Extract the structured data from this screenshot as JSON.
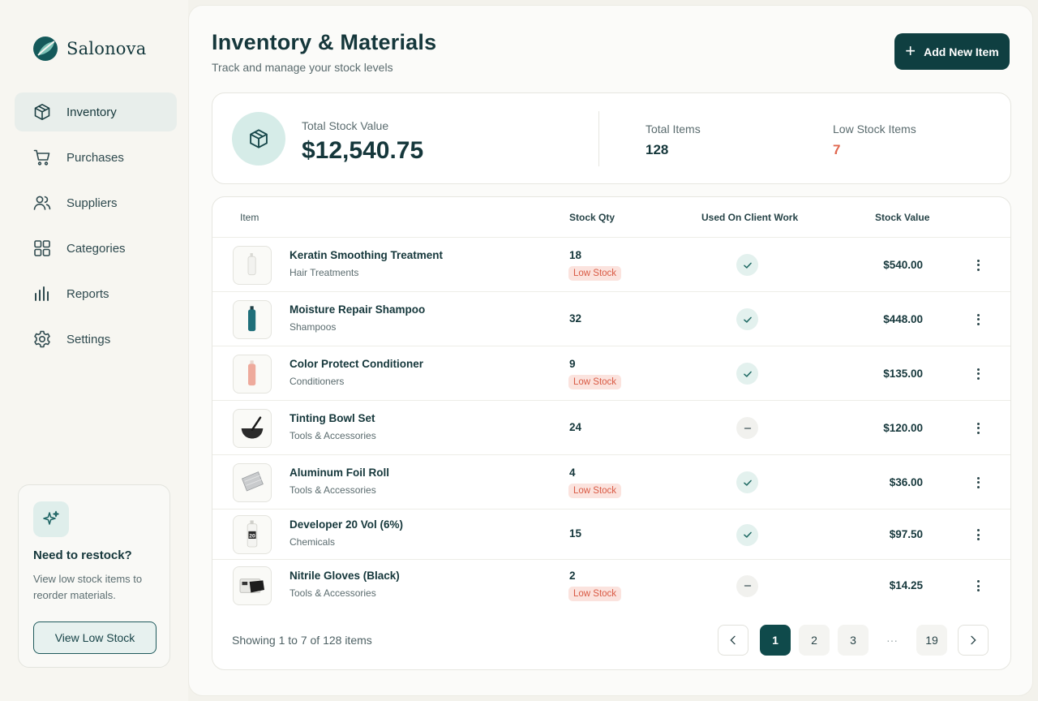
{
  "brand": {
    "name": "Salonova"
  },
  "nav": [
    {
      "label": "Inventory",
      "icon": "box-icon",
      "active": true
    },
    {
      "label": "Purchases",
      "icon": "cart-icon"
    },
    {
      "label": "Suppliers",
      "icon": "users-icon"
    },
    {
      "label": "Categories",
      "icon": "grid-icon"
    },
    {
      "label": "Reports",
      "icon": "bar-chart-icon"
    },
    {
      "label": "Settings",
      "icon": "gear-icon"
    }
  ],
  "restock": {
    "title": "Need to restock?",
    "description": "View low stock items to reorder materials.",
    "button": "View Low Stock"
  },
  "header": {
    "title": "Inventory & Materials",
    "subtitle": "Track and manage your stock levels",
    "add_button": "Add New Item"
  },
  "summary": {
    "total_stock_value_label": "Total Stock Value",
    "total_stock_value": "$12,540.75",
    "total_items_label": "Total Items",
    "total_items": "128",
    "low_stock_label": "Low Stock Items",
    "low_stock": "7"
  },
  "table": {
    "columns": {
      "item": "Item",
      "qty": "Stock Qty",
      "used": "Used On Client Work",
      "value": "Stock Value"
    },
    "low_stock_badge": "Low Stock",
    "rows": [
      {
        "name": "Keratin Smoothing Treatment",
        "category": "Hair Treatments",
        "qty": "18",
        "low": true,
        "used": true,
        "value": "$540.00",
        "thumb": "white-bottle"
      },
      {
        "name": "Moisture Repair Shampoo",
        "category": "Shampoos",
        "qty": "32",
        "low": false,
        "used": true,
        "value": "$448.00",
        "thumb": "teal-bottle"
      },
      {
        "name": "Color Protect Conditioner",
        "category": "Conditioners",
        "qty": "9",
        "low": true,
        "used": true,
        "value": "$135.00",
        "thumb": "pink-bottle"
      },
      {
        "name": "Tinting Bowl Set",
        "category": "Tools & Accessories",
        "qty": "24",
        "low": false,
        "used": false,
        "value": "$120.00",
        "thumb": "bowl"
      },
      {
        "name": "Aluminum Foil Roll",
        "category": "Tools & Accessories",
        "qty": "4",
        "low": true,
        "used": true,
        "value": "$36.00",
        "thumb": "foil"
      },
      {
        "name": "Developer 20 Vol (6%)",
        "category": "Chemicals",
        "qty": "15",
        "low": false,
        "used": true,
        "value": "$97.50",
        "thumb": "developer",
        "thumb_text": "20"
      },
      {
        "name": "Nitrile Gloves (Black)",
        "category": "Tools & Accessories",
        "qty": "2",
        "low": true,
        "used": false,
        "value": "$14.25",
        "thumb": "gloves"
      }
    ]
  },
  "pagination": {
    "summary": "Showing 1 to 7 of 128 items",
    "pages": [
      "1",
      "2",
      "3",
      "···",
      "19"
    ],
    "current": "1"
  },
  "colors": {
    "primary": "#0f3f41",
    "accent_soft": "#d6ece8",
    "warning": "#e0674f",
    "badge_bg": "#fbe3de"
  }
}
